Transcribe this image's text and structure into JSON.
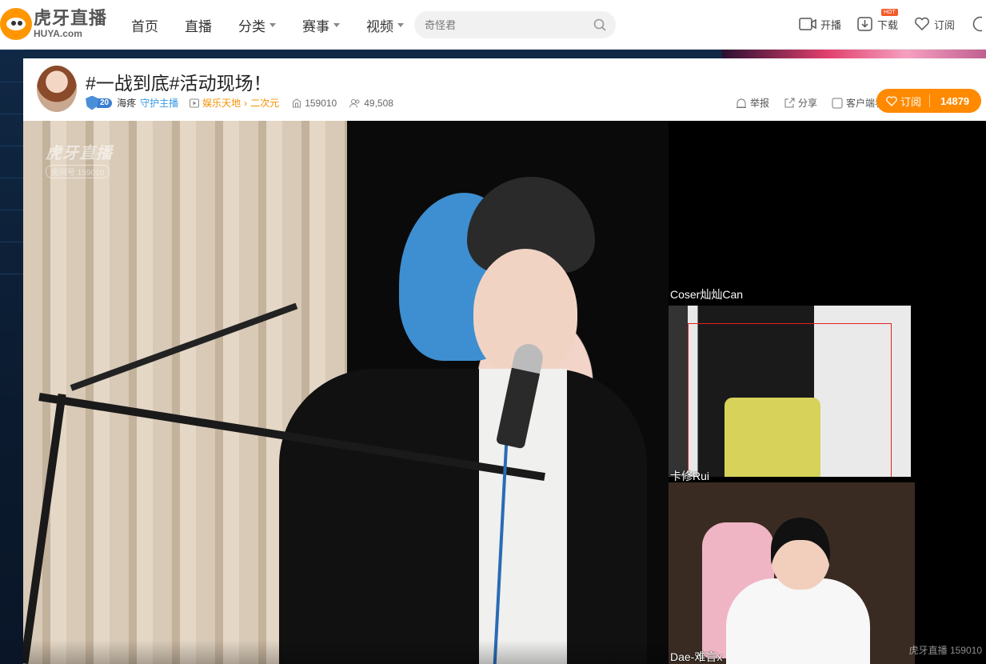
{
  "site": {
    "logo_cn": "虎牙直播",
    "logo_en": "HUYA.com",
    "brand_color": "#ff9600"
  },
  "nav": {
    "items": [
      {
        "label": "首页",
        "has_dropdown": false
      },
      {
        "label": "直播",
        "has_dropdown": false
      },
      {
        "label": "分类",
        "has_dropdown": true
      },
      {
        "label": "赛事",
        "has_dropdown": true
      },
      {
        "label": "视频",
        "has_dropdown": true
      }
    ]
  },
  "search": {
    "placeholder": "奇怪君",
    "icon": "search-icon"
  },
  "top_actions": {
    "broadcast": "开播",
    "download": "下载",
    "download_badge": "HOT",
    "subscribe": "订阅"
  },
  "room": {
    "title": "#一战到底#活动现场！",
    "level": "20",
    "host_name": "海疼",
    "guard_label": "守护主播",
    "category": "娱乐天地",
    "subcategory": "二次元",
    "room_id": "159010",
    "viewers": "49,508",
    "report": "举报",
    "share": "分享",
    "client_watch": "客户端看",
    "subscribe_label": "订阅",
    "subscribe_count": "14879",
    "accent_color": "#ff8a00"
  },
  "player": {
    "watermark_logo": "虎牙直播",
    "watermark_room": "房间号 159010",
    "corner_watermark": "虎牙直播 159010",
    "guests": [
      {
        "name": "Coser灿灿Can"
      },
      {
        "name": "卡修Rui"
      },
      {
        "name": "Dae-难言x"
      }
    ]
  }
}
